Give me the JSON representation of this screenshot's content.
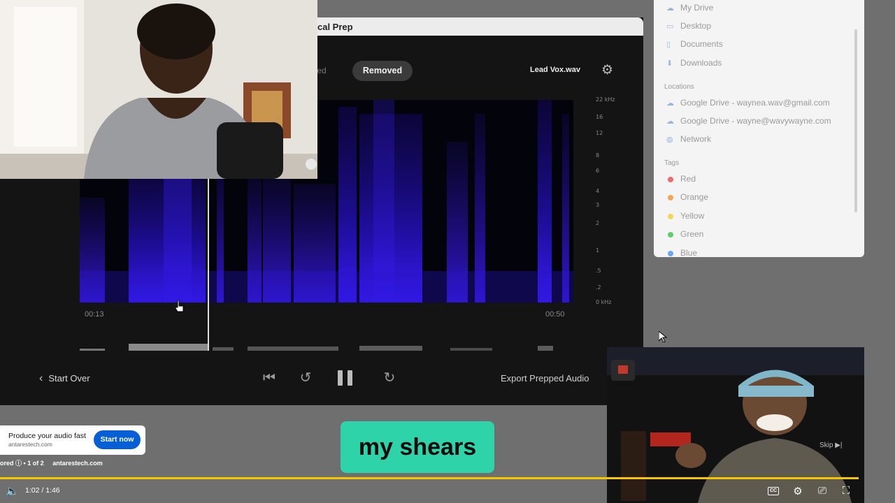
{
  "app": {
    "title": "cal Prep",
    "tab_previous": "pped",
    "tab_active": "Removed",
    "file_name": "Lead Vox.wav",
    "settings_icon": "gear-icon",
    "freq_labels": [
      "22 kHz",
      "16",
      "12",
      "8",
      "6",
      "4",
      "3",
      "2",
      "1",
      ".5",
      ".2",
      "0 kHz"
    ],
    "time_start": "00:13",
    "time_end": "00:50",
    "start_over_label": "Start Over",
    "export_label": "Export Prepped Audio"
  },
  "finder": {
    "favorites": [
      {
        "label": "My Drive",
        "icon": "cloud-drive-icon"
      },
      {
        "label": "Desktop",
        "icon": "desktop-icon"
      },
      {
        "label": "Documents",
        "icon": "document-icon"
      },
      {
        "label": "Downloads",
        "icon": "download-icon"
      }
    ],
    "locations_title": "Locations",
    "locations": [
      {
        "label": "Google Drive - waynea.wav@gmail.com",
        "icon": "cloud-drive-icon"
      },
      {
        "label": "Google Drive - wayne@wavywayne.com",
        "icon": "cloud-drive-icon"
      },
      {
        "label": "Network",
        "icon": "network-icon"
      }
    ],
    "tags_title": "Tags",
    "tags": [
      {
        "label": "Red",
        "color": "#f26b6b"
      },
      {
        "label": "Orange",
        "color": "#f5a45a"
      },
      {
        "label": "Yellow",
        "color": "#f2d65a"
      },
      {
        "label": "Green",
        "color": "#5fcf6b"
      },
      {
        "label": "Blue",
        "color": "#6aa7f0"
      }
    ]
  },
  "ad": {
    "title": "Produce your audio fast",
    "url": "antarestech.com",
    "cta": "Start now",
    "meta_sponsored": "ored",
    "meta_count": "1 of 2",
    "meta_domain": "antarestech.com"
  },
  "caption": "my shears",
  "host_video": {
    "skip_label": "Skip"
  },
  "player": {
    "time": "1:02 / 1:46",
    "progress_fraction": 0.959,
    "accent": "#f7c600"
  }
}
